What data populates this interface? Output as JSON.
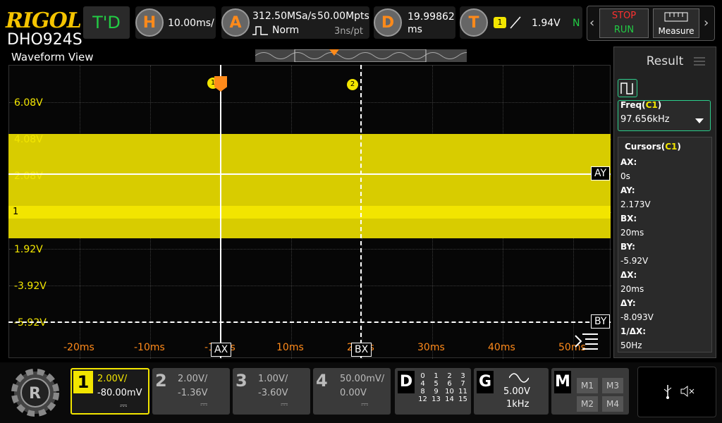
{
  "header": {
    "brand": "RIGOL",
    "model": "DHO924S",
    "trigger_mode_button": "T'D",
    "horizontal": {
      "icon_letter": "H",
      "timebase": "10.00ms/"
    },
    "acquire": {
      "icon_letter": "A",
      "sample_rate": "312.50MSa/s",
      "memory_depth": "50.00Mpts",
      "mode": "Norm",
      "resolution": "3ns/pt"
    },
    "delay": {
      "icon_letter": "D",
      "value": "19.99862",
      "unit": "ms"
    },
    "trigger": {
      "icon_letter": "T",
      "source": "1",
      "level": "1.94V",
      "status": "N"
    },
    "run_stop": {
      "stop": "STOP",
      "run": "RUN"
    },
    "measure_label": "Measure"
  },
  "waveform": {
    "title": "Waveform View",
    "volt_labels": [
      "6.08V",
      "4.08V",
      "2.08V",
      "1.92V",
      "-3.92V",
      "-5.92V"
    ],
    "time_labels": [
      "-20ms",
      "-10ms",
      "-10ms",
      "10ms",
      "20ms",
      "30ms",
      "40ms",
      "50ms"
    ],
    "channel_marker": "1",
    "trigger_marker": "1",
    "cursor_marker_2": "2",
    "cursor_labels": {
      "ax": "AX",
      "bx": "BX",
      "ay": "AY",
      "by": "BY"
    }
  },
  "result": {
    "title": "Result",
    "freq_label": "Freq(",
    "freq_source": "C1",
    "freq_close": ")",
    "freq_value": "97.656kHz",
    "cursors_label": "Cursors(",
    "cursors_source": "C1",
    "cursors_close": ")",
    "items": [
      {
        "label": "AX:",
        "value": "0s"
      },
      {
        "label": "AY:",
        "value": "2.173V"
      },
      {
        "label": "BX:",
        "value": "20ms"
      },
      {
        "label": "BY:",
        "value": "-5.92V"
      },
      {
        "label": "ΔX:",
        "value": "20ms"
      },
      {
        "label": "ΔY:",
        "value": "-8.093V"
      },
      {
        "label": "1/ΔX:",
        "value": "50Hz"
      }
    ]
  },
  "channels": [
    {
      "num": "1",
      "scale": "2.00V/",
      "offset": "-80.00mV"
    },
    {
      "num": "2",
      "scale": "2.00V/",
      "offset": "-1.36V"
    },
    {
      "num": "3",
      "scale": "1.00V/",
      "offset": "-3.60V"
    },
    {
      "num": "4",
      "scale": "50.00mV/",
      "offset": "0.00V"
    }
  ],
  "digital": {
    "letter": "D",
    "numbers": [
      "0",
      "1",
      "2",
      "3",
      "4",
      "5",
      "6",
      "7",
      "8",
      "9",
      "10",
      "11",
      "12",
      "13",
      "14",
      "15"
    ]
  },
  "generator": {
    "letter": "G",
    "amplitude": "5.00V",
    "frequency": "1kHz"
  },
  "math": {
    "letter": "M",
    "items": [
      "M1",
      "M3",
      "M2",
      "M4"
    ]
  },
  "colors": {
    "ch1": "#f2e500",
    "accent": "#ff8a1a",
    "tmode": "#22cc44",
    "stop": "#ff3030"
  }
}
